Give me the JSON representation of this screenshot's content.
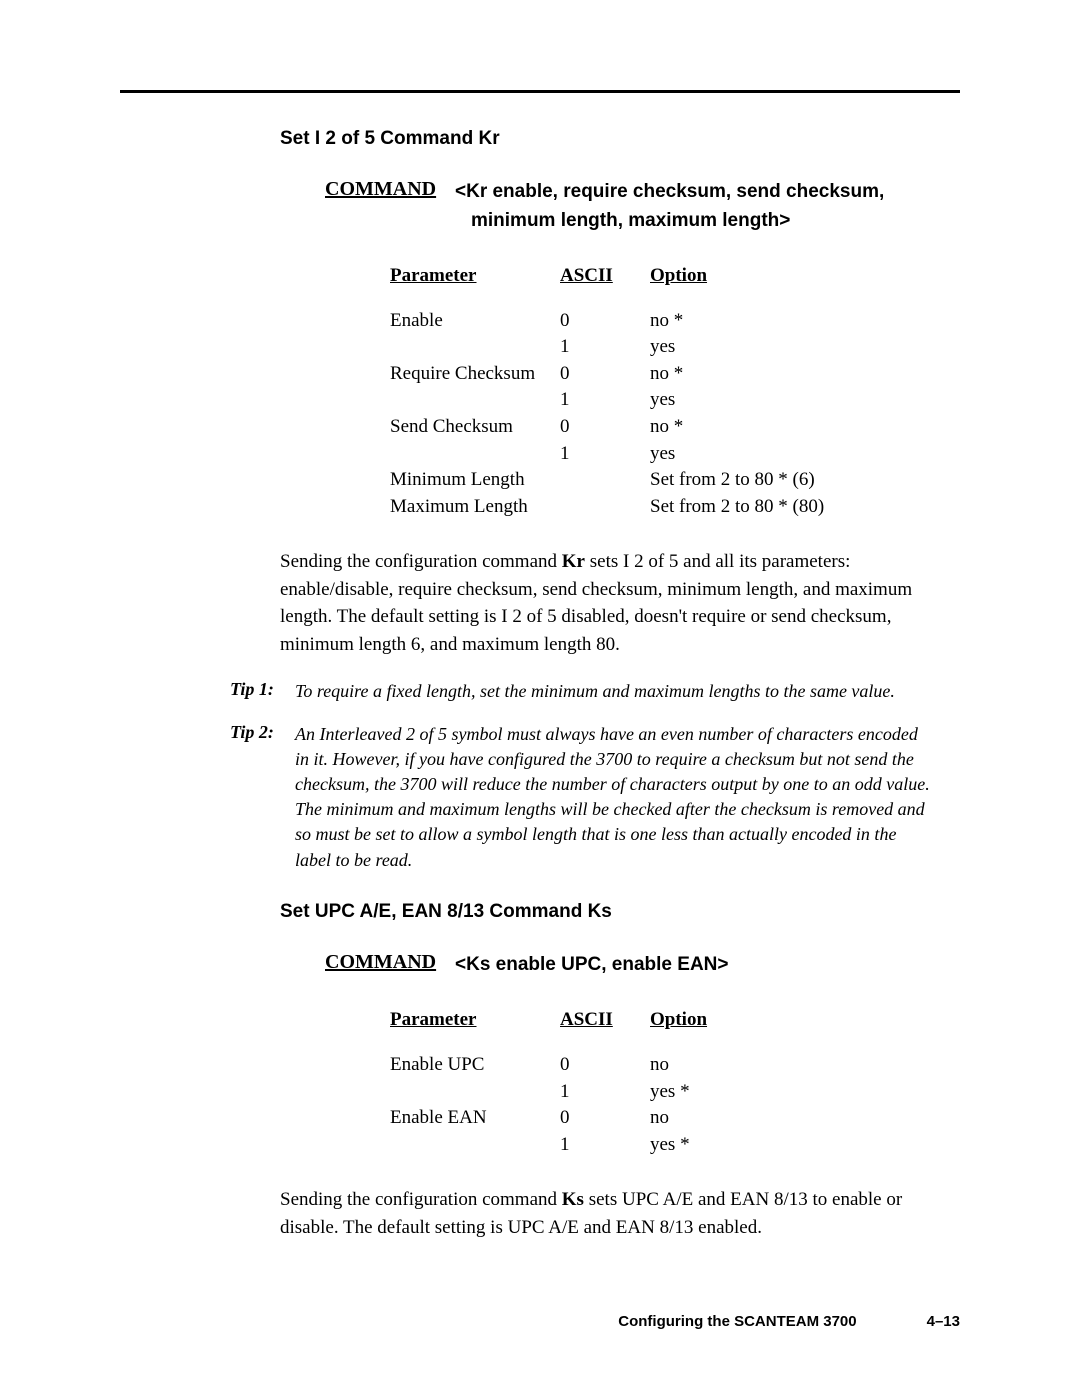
{
  "section1": {
    "title": "Set I 2 of 5 Command Kr",
    "cmd_label": "COMMAND",
    "cmd_syntax_l1": "<Kr enable, require checksum, send checksum,",
    "cmd_syntax_l2": "minimum length, maximum length>",
    "headers": {
      "parameter": "Parameter",
      "ascii": "ASCII",
      "option": "Option"
    },
    "rows": [
      {
        "param": "Enable",
        "ascii": "0",
        "option": "no *"
      },
      {
        "param": "",
        "ascii": "1",
        "option": "yes"
      },
      {
        "param": "Require Checksum",
        "ascii": "0",
        "option": "no *"
      },
      {
        "param": "",
        "ascii": "1",
        "option": "yes"
      },
      {
        "param": "Send Checksum",
        "ascii": "0",
        "option": "no *"
      },
      {
        "param": "",
        "ascii": "1",
        "option": "yes"
      },
      {
        "param": "Minimum Length",
        "ascii": "",
        "option": "Set from 2 to 80 * (6)"
      },
      {
        "param": "Maximum Length",
        "ascii": "",
        "option": "Set from 2 to 80 * (80)"
      }
    ],
    "desc_pre": "Sending the configuration command ",
    "desc_bold": "Kr",
    "desc_post": " sets I 2 of 5 and all its parameters: enable/disable, require checksum, send checksum, minimum length, and maximum length.  The default setting is I 2 of 5 disabled, doesn't require or send checksum, minimum length 6, and maximum length 80."
  },
  "tips": [
    {
      "label": "Tip 1:",
      "text": "To require a fixed length, set the minimum and maximum lengths to the same value."
    },
    {
      "label": "Tip 2:",
      "text": "An Interleaved 2 of 5 symbol must always have an even number of characters encoded in it.  However, if you have configured the 3700 to require a checksum but not send the checksum, the 3700 will reduce the number of characters output by one to an odd value.  The minimum and maximum lengths will be checked after the checksum is removed and so must be set to allow a symbol length that is one less than actually encoded in the label to be read."
    }
  ],
  "section2": {
    "title": "Set UPC A/E, EAN 8/13 Command Ks",
    "cmd_label": "COMMAND",
    "cmd_syntax": "<Ks enable UPC, enable EAN>",
    "headers": {
      "parameter": "Parameter",
      "ascii": "ASCII",
      "option": "Option"
    },
    "rows": [
      {
        "param": "Enable UPC",
        "ascii": "0",
        "option": "no"
      },
      {
        "param": "",
        "ascii": "1",
        "option": "yes *"
      },
      {
        "param": "Enable EAN",
        "ascii": "0",
        "option": "no"
      },
      {
        "param": "",
        "ascii": "1",
        "option": "yes *"
      }
    ],
    "desc_pre": "Sending the configuration command ",
    "desc_bold": "Ks",
    "desc_post": " sets UPC A/E and EAN 8/13 to enable or disable.  The default setting is UPC A/E and EAN 8/13 enabled."
  },
  "footer": {
    "title": "Configuring the SCANTEAM 3700",
    "page": "4–13"
  }
}
